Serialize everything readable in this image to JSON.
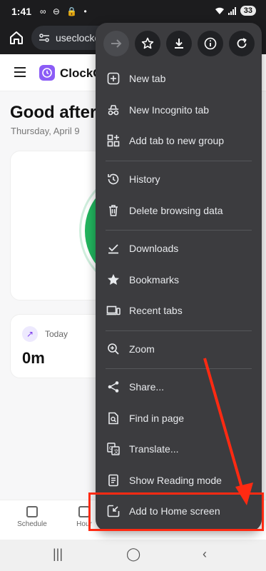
{
  "status_bar": {
    "time": "1:41",
    "left_icons": "∞ ⊖ 🔒 •",
    "battery": "33"
  },
  "browser": {
    "url": "useclocko"
  },
  "app": {
    "name": "ClockO",
    "greeting": "Good aftern",
    "date": "Thursday, April 9",
    "today_label": "Today",
    "today_value": "0m",
    "bottom_nav": [
      {
        "label": "Schedule"
      },
      {
        "label": "Hour"
      }
    ]
  },
  "menu": {
    "top_buttons": [
      {
        "name": "forward-icon"
      },
      {
        "name": "bookmark-star-icon"
      },
      {
        "name": "download-icon"
      },
      {
        "name": "info-icon"
      },
      {
        "name": "refresh-icon"
      }
    ],
    "items": [
      {
        "label": "New tab",
        "icon": "new-tab-icon"
      },
      {
        "label": "New Incognito tab",
        "icon": "incognito-icon"
      },
      {
        "label": "Add tab to new group",
        "icon": "tab-group-icon"
      },
      {
        "label": "History",
        "icon": "history-icon"
      },
      {
        "label": "Delete browsing data",
        "icon": "trash-icon"
      },
      {
        "label": "Downloads",
        "icon": "downloads-icon"
      },
      {
        "label": "Bookmarks",
        "icon": "star-icon"
      },
      {
        "label": "Recent tabs",
        "icon": "recent-tabs-icon"
      },
      {
        "label": "Zoom",
        "icon": "zoom-icon"
      },
      {
        "label": "Share...",
        "icon": "share-icon"
      },
      {
        "label": "Find in page",
        "icon": "find-icon"
      },
      {
        "label": "Translate...",
        "icon": "translate-icon"
      },
      {
        "label": "Show Reading mode",
        "icon": "reading-mode-icon"
      },
      {
        "label": "Add to Home screen",
        "icon": "add-to-home-icon"
      }
    ]
  },
  "colors": {
    "menu_bg": "#3c3c3f",
    "annotation": "#ff2a12",
    "accent_green": "#22b45e",
    "brand_purple": "#8b5cf6"
  }
}
